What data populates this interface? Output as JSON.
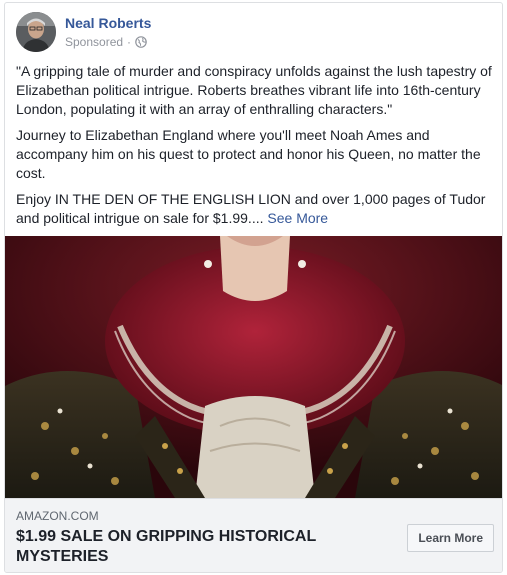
{
  "post": {
    "author": "Neal Roberts",
    "sponsored_label": "Sponsored",
    "sponsored_separator": "·",
    "privacy_icon": "globe-icon",
    "paragraphs": [
      "\"A gripping tale of murder and conspiracy unfolds against the lush tapestry of Elizabethan political intrigue. Roberts breathes vibrant life into 16th-century London, populating it with an array of enthralling characters.\"",
      "Journey to Elizabethan England where you'll meet Noah Ames and accompany him on his quest to protect and honor his Queen, no matter the cost."
    ],
    "last_paragraph": "Enjoy IN THE DEN OF THE ENGLISH LION and over 1,000 pages of Tudor and political intrigue on sale for $1.99....",
    "see_more": "See More"
  },
  "link": {
    "domain": "AMAZON.COM",
    "headline": "$1.99 SALE ON GRIPPING HISTORICAL MYSTERIES",
    "cta_label": "Learn More"
  },
  "colors": {
    "link_blue": "#365899",
    "meta_gray": "#90949c",
    "ruff_red": "#8b1a2b",
    "backdrop_red": "#4a0f16"
  }
}
